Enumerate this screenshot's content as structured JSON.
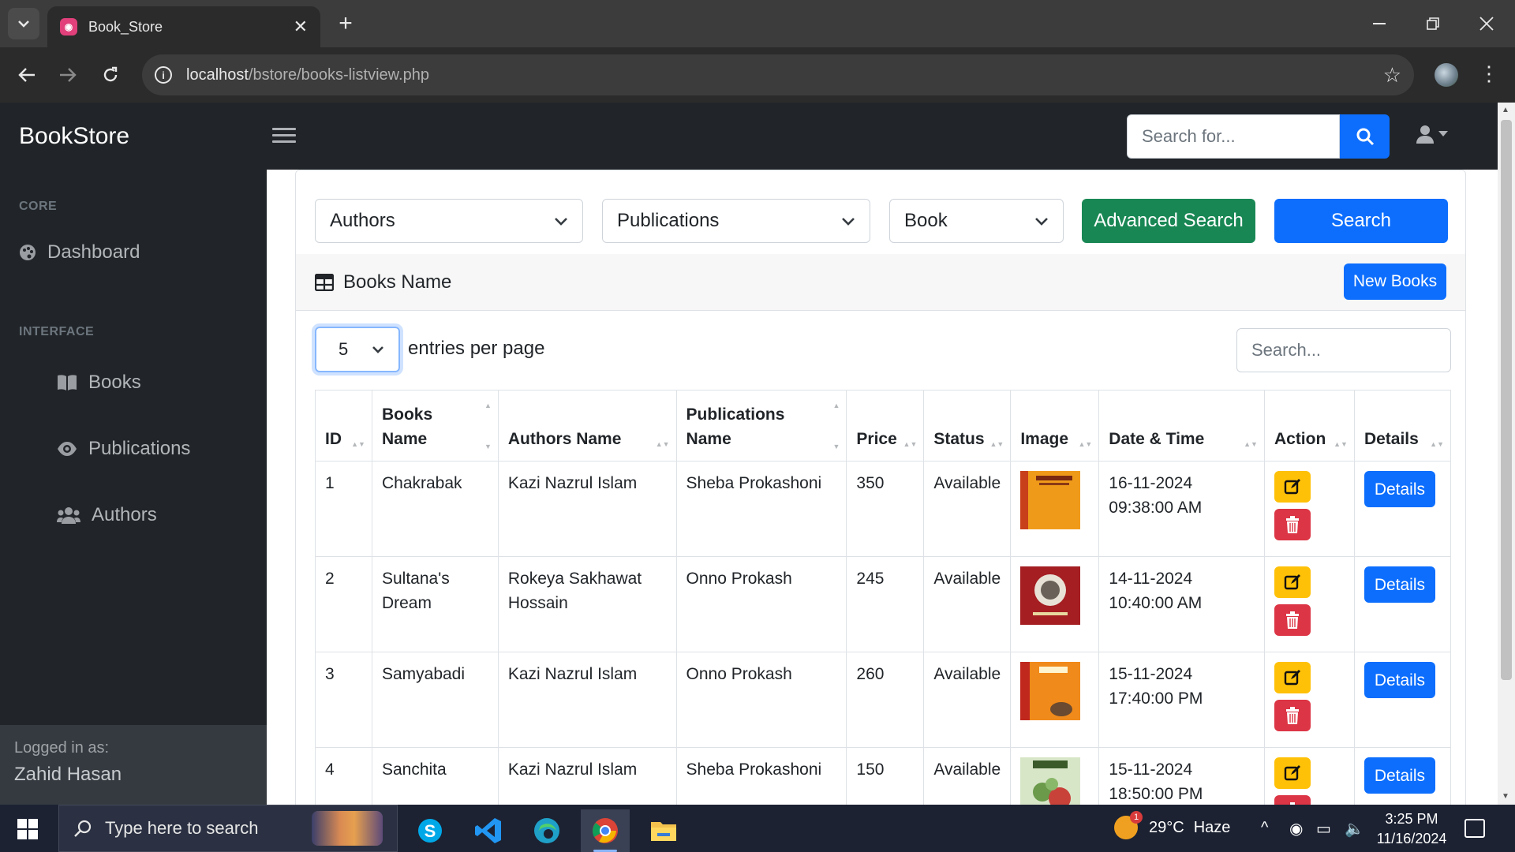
{
  "browser": {
    "tab_title": "Book_Store",
    "url_host": "localhost",
    "url_path": "/bstore/books-listview.php"
  },
  "app": {
    "brand": "BookStore",
    "top_search_placeholder": "Search for..."
  },
  "sidebar": {
    "core_heading": "CORE",
    "interface_heading": "INTERFACE",
    "items": [
      {
        "label": "Dashboard",
        "icon": "palette-icon"
      },
      {
        "label": "Books",
        "icon": "book-open-icon"
      },
      {
        "label": "Publications",
        "icon": "eye-icon"
      },
      {
        "label": "Authors",
        "icon": "users-icon"
      }
    ],
    "footer_label": "Logged in as:",
    "footer_user": "Zahid Hasan"
  },
  "filters": {
    "authors": "Authors",
    "publications": "Publications",
    "book": "Book",
    "advanced_search": "Advanced Search",
    "search": "Search"
  },
  "card": {
    "title": "Books Name",
    "new_button": "New Books"
  },
  "datatable": {
    "per_page_value": "5",
    "per_page_label": "entries per page",
    "search_placeholder": "Search...",
    "headers": [
      "ID",
      "Books Name",
      "Authors Name",
      "Publications Name",
      "Price",
      "Status",
      "Image",
      "Date & Time",
      "Action",
      "Details"
    ],
    "rows": [
      {
        "id": "1",
        "name": "Chakrabak",
        "author": "Kazi Nazrul Islam",
        "publication": "Sheba Prokashoni",
        "price": "350",
        "status": "Available",
        "date": "16-11-2024",
        "time": "09:38:00 AM",
        "details": "Details"
      },
      {
        "id": "2",
        "name": "Sultana's Dream",
        "author": "Rokeya Sakhawat Hossain",
        "publication": "Onno Prokash",
        "price": "245",
        "status": "Available",
        "date": "14-11-2024",
        "time": "10:40:00 AM",
        "details": "Details"
      },
      {
        "id": "3",
        "name": "Samyabadi",
        "author": "Kazi Nazrul Islam",
        "publication": "Onno Prokash",
        "price": "260",
        "status": "Available",
        "date": "15-11-2024",
        "time": "17:40:00 PM",
        "details": "Details"
      },
      {
        "id": "4",
        "name": "Sanchita",
        "author": "Kazi Nazrul Islam",
        "publication": "Sheba Prokashoni",
        "price": "150",
        "status": "Available",
        "date": "15-11-2024",
        "time": "18:50:00 PM",
        "details": "Details"
      }
    ]
  },
  "taskbar": {
    "search_placeholder": "Type here to search",
    "weather_badge": "1",
    "temperature": "29°C",
    "weather_text": "Haze",
    "time": "3:25 PM",
    "date": "11/16/2024"
  },
  "colors": {
    "primary": "#0d6efd",
    "success": "#198754",
    "warning": "#ffc107",
    "danger": "#dc3545",
    "sidebar_bg": "#212529"
  }
}
